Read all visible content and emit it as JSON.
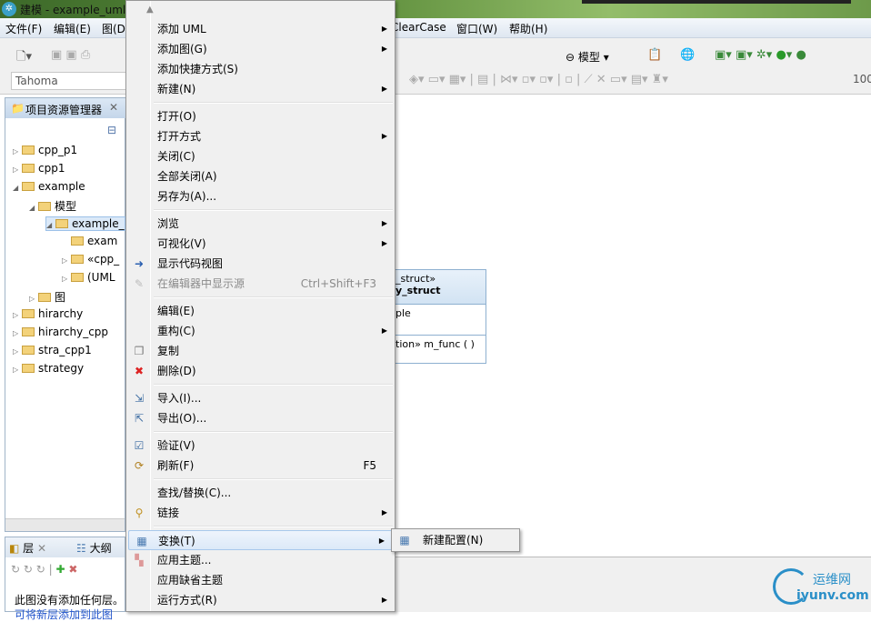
{
  "window": {
    "title": "建模 - example_uml::"
  },
  "menubar": [
    "文件(F)",
    "编辑(E)",
    "图(D)",
    "ClearCase",
    "窗口(W)",
    "帮助(H)"
  ],
  "toolbar": {
    "perspective": "模型",
    "font": "Tahoma",
    "zoom": "100"
  },
  "explorer": {
    "title": "项目资源管理器",
    "items": [
      {
        "label": "cpp_p1",
        "depth": 0,
        "exp": "▷"
      },
      {
        "label": "cpp1",
        "depth": 0,
        "exp": "▷"
      },
      {
        "label": "example",
        "depth": 0,
        "exp": "◢"
      },
      {
        "label": "模型",
        "depth": 1,
        "exp": "◢"
      },
      {
        "label": "example_",
        "depth": 2,
        "exp": "◢"
      },
      {
        "label": "exam",
        "depth": 3,
        "exp": ""
      },
      {
        "label": "«cpp_",
        "depth": 3,
        "exp": "▷"
      },
      {
        "label": "(UML",
        "depth": 3,
        "exp": "▷"
      },
      {
        "label": "图",
        "depth": 1,
        "exp": "▷"
      },
      {
        "label": "hirarchy",
        "depth": 0,
        "exp": "▷"
      },
      {
        "label": "hirarchy_cpp",
        "depth": 0,
        "exp": "▷"
      },
      {
        "label": "stra_cpp1",
        "depth": 0,
        "exp": "▷"
      },
      {
        "label": "strategy",
        "depth": 0,
        "exp": "▷"
      }
    ]
  },
  "layers": {
    "tab1": "层",
    "tab2": "大纲",
    "message": "此图没有添加任何层。",
    "link": "可将新层添加到此图"
  },
  "uml": {
    "stereotype": "_struct»",
    "name": "y_struct",
    "attr": "ple",
    "op": "tion» m_func ( )"
  },
  "context_menu": [
    {
      "label": "添加 UML",
      "sub": true
    },
    {
      "label": "添加图(G)",
      "sub": true
    },
    {
      "label": "添加快捷方式(S)"
    },
    {
      "label": "新建(N)",
      "sub": true
    },
    {
      "sep": true
    },
    {
      "label": "打开(O)"
    },
    {
      "label": "打开方式",
      "sub": true
    },
    {
      "label": "关闭(C)"
    },
    {
      "label": "全部关闭(A)"
    },
    {
      "label": "另存为(A)..."
    },
    {
      "sep": true
    },
    {
      "label": "浏览",
      "sub": true
    },
    {
      "label": "可视化(V)",
      "sub": true
    },
    {
      "label": "显示代码视图",
      "icon": "code-view-icon"
    },
    {
      "label": "在编辑器中显示源",
      "shortcut": "Ctrl+Shift+F3",
      "disabled": true,
      "icon": "source-icon"
    },
    {
      "sep": true
    },
    {
      "label": "编辑(E)"
    },
    {
      "label": "重构(C)",
      "sub": true
    },
    {
      "label": "复制",
      "icon": "copy-icon"
    },
    {
      "label": "删除(D)",
      "icon": "delete-icon"
    },
    {
      "sep": true
    },
    {
      "label": "导入(I)...",
      "icon": "import-icon"
    },
    {
      "label": "导出(O)...",
      "icon": "export-icon"
    },
    {
      "sep": true
    },
    {
      "label": "验证(V)",
      "icon": "validate-icon"
    },
    {
      "label": "刷新(F)",
      "shortcut": "F5",
      "icon": "refresh-icon"
    },
    {
      "sep": true
    },
    {
      "label": "查找/替换(C)..."
    },
    {
      "label": "链接",
      "sub": true,
      "icon": "link-icon"
    },
    {
      "sep": true
    },
    {
      "label": "变换(T)",
      "sub": true,
      "highlighted": true,
      "icon": "transform-icon"
    },
    {
      "label": "应用主题...",
      "icon": "theme-icon"
    },
    {
      "label": "应用缺省主题"
    },
    {
      "label": "运行方式(R)",
      "sub": true
    }
  ],
  "submenu": [
    {
      "label": "新建配置(N)"
    }
  ],
  "watermark": {
    "cn": "运维网",
    "url": "iyunv.com"
  }
}
